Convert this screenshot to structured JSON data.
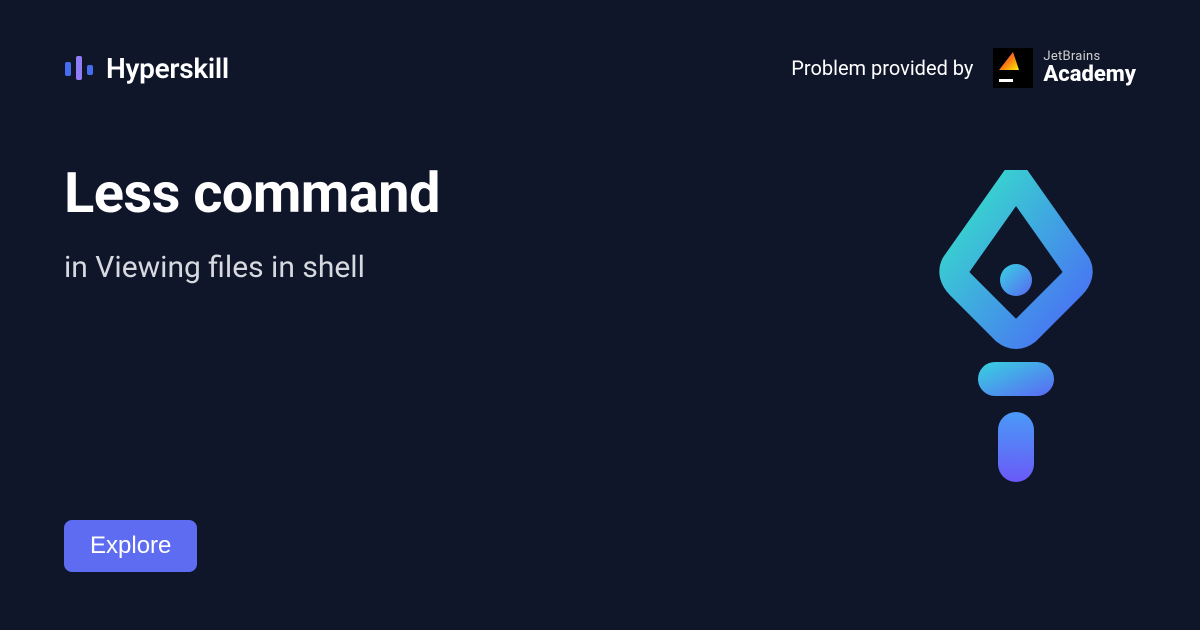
{
  "header": {
    "brand": "Hyperskill",
    "provided_by": "Problem provided by",
    "partner_top": "JetBrains",
    "partner_bottom": "Academy"
  },
  "main": {
    "title": "Less command",
    "subtitle": "in Viewing files in shell"
  },
  "cta": {
    "explore": "Explore"
  }
}
